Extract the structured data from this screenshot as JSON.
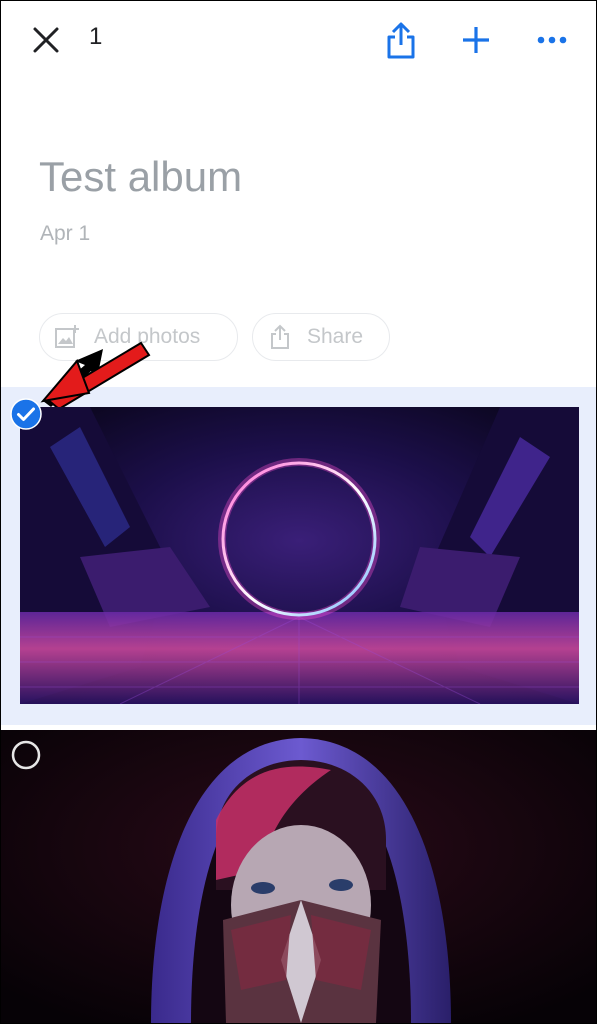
{
  "toolbar": {
    "selected_count": "1",
    "icons": [
      "close-icon",
      "share-icon",
      "add-icon",
      "more-icon"
    ],
    "accent_color": "#1a73e8"
  },
  "album": {
    "title": "Test album",
    "date": "Apr 1"
  },
  "actions": {
    "add_photos_label": "Add photos",
    "share_label": "Share"
  },
  "photos": [
    {
      "selected": true,
      "subject": "neon ring portal"
    },
    {
      "selected": false,
      "subject": "hooded figure with mask"
    }
  ],
  "colors": {
    "selection_bg": "#e8eefc",
    "annotation_arrow": "#e31b1b"
  }
}
